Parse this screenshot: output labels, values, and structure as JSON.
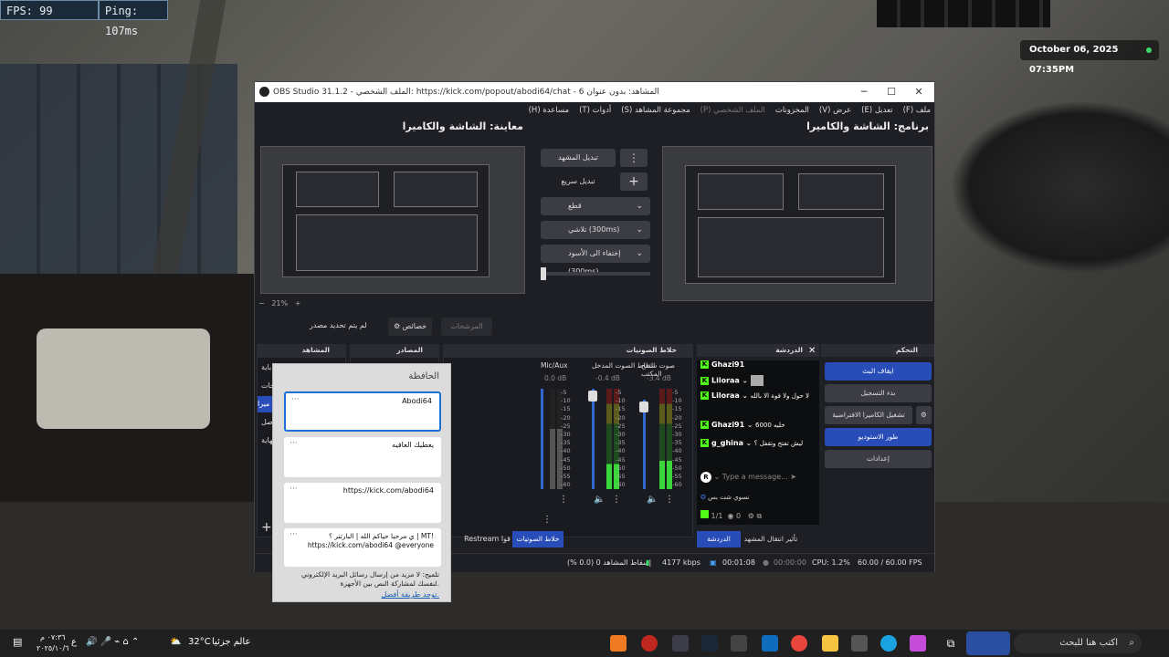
{
  "hud": {
    "fps": "FPS: 99",
    "ping": "Ping: 107ms"
  },
  "date_pill": "October 06, 2025 07:35PM",
  "obs": {
    "title": "OBS Studio 31.1.2 - الملف الشخصي: https://kick.com/popout/abodi64/chat - 6 المشاهد: بدون عنوان",
    "menu": [
      "ملف (F)",
      "تعديل (E)",
      "عرض (V)",
      "المخزونات",
      "الملف الشخصي (P)",
      "مجموعة المشاهد (S)",
      "أدوات (T)",
      "مساعدة (H)"
    ],
    "program_label": "برنامج: الشاشة والكاميرا",
    "preview_label": "معاينة: الشاشة والكاميرا",
    "transition": {
      "scene_label": "تبديل المشهد",
      "quick_label": "تبديل سريع",
      "cut": "قطع",
      "fade": "تلاشي (300ms)",
      "fade_black": "إختفاء الى الأسود (300ms)"
    },
    "zoom": "21%",
    "no_source": "لم يتم تحديد مصدر",
    "properties": "خصائص",
    "filters": "المرشحات",
    "panels": {
      "scenes": "المشاهد",
      "sources": "المصادر",
      "mixer": "خلاط الصوتيات",
      "chat": "الدردشة",
      "controls": "التحكم"
    },
    "scenes_items": [
      "باية",
      "حات",
      "ميرا",
      "صل",
      "نهاية"
    ],
    "mixer": [
      {
        "name": "صوت سطح المكتب",
        "db": "-3.4 dB"
      },
      {
        "name": "التقاط الصوت المدخل",
        "db": "-0.4 dB"
      },
      {
        "name": "Mic/Aux",
        "db": "0.0 dB"
      }
    ],
    "meter_ticks": [
      "-5",
      "-10",
      "-15",
      "-20",
      "-25",
      "-30",
      "-35",
      "-40",
      "-45",
      "-50",
      "-55",
      "-60"
    ],
    "controls": [
      {
        "label": "ايقاف البث",
        "active": true
      },
      {
        "label": "بدء التسجيل",
        "active": false
      },
      {
        "label": "تشغيل الكاميرا الافتراضية",
        "active": false
      },
      {
        "label": "طور الاستوديو",
        "active": true
      },
      {
        "label": "إعدادات",
        "active": false
      }
    ],
    "chat_messages": [
      {
        "user": "Ghazi91",
        "text": ""
      },
      {
        "user": "Liloraa",
        "text": ""
      },
      {
        "user": "Liloraa",
        "text": "لا حول ولا قوة الا بالله"
      },
      {
        "user": "Ghazi91",
        "text": "خليه 6000"
      },
      {
        "user": "g_ghina",
        "text": "ليش تفتح وتقفل ؟"
      }
    ],
    "chat_placeholder": "Type a message...",
    "chat_bottom_text": "نسوي شت بس",
    "chat_counts": {
      "viewers": "1/1",
      "views": "0"
    },
    "tabs": {
      "chat": "الدردشة",
      "scene_transitions": "تأثير انتقال المشهد",
      "mixer": "خلاط الصوتيات",
      "restream": "Restream",
      "quick": "قوا"
    },
    "status": {
      "dropped": "إسقاط المشاهد 0 (0.0 %)",
      "kbps": "4177 kbps",
      "rec_time": "00:01:08",
      "stream_time": "00:00:00",
      "cpu": "CPU: 1.2%",
      "fps": "60.00 / 60.00 FPS"
    }
  },
  "clipboard": {
    "title": "الحافظة",
    "items": [
      "Abodi64",
      "يعطيك العافيه",
      "https://kick.com/abodi64",
      "ي مرحبا حياكم الله | البارتنر ؟ | MT! https://kick.com/abodi64 @everyone"
    ],
    "tip": "تلميح: لا مزيد من إرسال رسائل البريد الإلكتروني لنفسك لمشاركة النص بين الأجهزة.",
    "link": "توجد طريقة أفضل."
  },
  "taskbar": {
    "search": "اكتب هنا للبحث",
    "weather": "عالم جزئيا",
    "temp": "32°C",
    "time": "٠٧:٣٦ م",
    "date": "٢٠٢٥/١٠/٦",
    "lang": "ع"
  }
}
